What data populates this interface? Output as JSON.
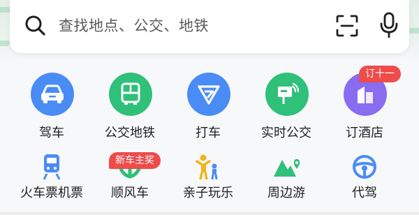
{
  "search": {
    "placeholder": "查找地点、公交、地铁"
  },
  "icons": {
    "search": "search-icon",
    "scan": "scan-icon",
    "mic": "microphone-icon"
  },
  "services_row1": [
    {
      "label": "驾车",
      "icon": "car-icon",
      "color": "#4a8cf5"
    },
    {
      "label": "公交地铁",
      "icon": "bus-icon",
      "color": "#2fc07a"
    },
    {
      "label": "打车",
      "icon": "taxi-icon",
      "color": "#4a8cf5"
    },
    {
      "label": "实时公交",
      "icon": "bus-stop-icon",
      "color": "#2fc07a"
    },
    {
      "label": "订酒店",
      "icon": "hotel-icon",
      "color": "#8a6cf0",
      "badge": "订十一"
    }
  ],
  "services_row2": [
    {
      "label": "火车票机票",
      "icon": "train-icon",
      "color": "#4a8cf5"
    },
    {
      "label": "顺风车",
      "icon": "carpool-icon",
      "color": "#2fc07a",
      "badge": "新车主奖"
    },
    {
      "label": "亲子玩乐",
      "icon": "family-icon",
      "color": "#f2b31c"
    },
    {
      "label": "周边游",
      "icon": "mountain-location-icon",
      "color": "#2fc07a"
    },
    {
      "label": "代驾",
      "icon": "steering-wheel-icon",
      "color": "#4a8cf5"
    }
  ],
  "colors": {
    "blue": "#4a8cf5",
    "green": "#2fc07a",
    "purple": "#8a6cf0",
    "yellow": "#f2b31c",
    "badge_red": "#ef4b4b"
  }
}
